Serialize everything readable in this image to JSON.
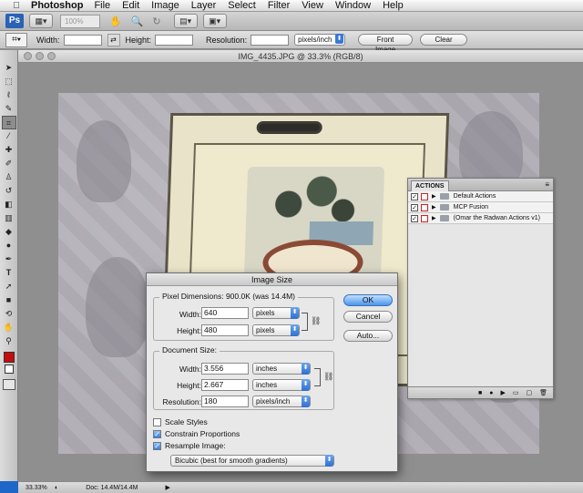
{
  "menubar": {
    "app_name": "Photoshop",
    "items": [
      "File",
      "Edit",
      "Image",
      "Layer",
      "Select",
      "Filter",
      "View",
      "Window",
      "Help"
    ]
  },
  "appbar": {
    "logo": "Ps",
    "zoom": "100%"
  },
  "options": {
    "width_label": "Width:",
    "height_label": "Height:",
    "resolution_label": "Resolution:",
    "units": "pixels/inch",
    "front_image": "Front Image",
    "clear": "Clear"
  },
  "document": {
    "title": "IMG_4435.JPG @ 33.3% (RGB/8)"
  },
  "actions_panel": {
    "tab": "ACTIONS",
    "rows": [
      {
        "name": "Default Actions"
      },
      {
        "name": "MCP Fusion"
      },
      {
        "name": "(Omar the Radwan Actions v1)"
      }
    ]
  },
  "dialog": {
    "title": "Image Size",
    "pixel_dimensions_label": "Pixel Dimensions:",
    "pixel_dimensions_value": "900.0K (was 14.4M)",
    "px_width_label": "Width:",
    "px_width_value": "640",
    "px_width_unit": "pixels",
    "px_height_label": "Height:",
    "px_height_value": "480",
    "px_height_unit": "pixels",
    "document_size_label": "Document Size:",
    "doc_width_label": "Width:",
    "doc_width_value": "3.556",
    "doc_width_unit": "inches",
    "doc_height_label": "Height:",
    "doc_height_value": "2.667",
    "doc_height_unit": "inches",
    "resolution_label": "Resolution:",
    "resolution_value": "180",
    "resolution_unit": "pixels/inch",
    "scale_styles": "Scale Styles",
    "constrain_proportions": "Constrain Proportions",
    "resample_image": "Resample Image:",
    "resample_method": "Bicubic (best for smooth gradients)",
    "ok": "OK",
    "cancel": "Cancel",
    "auto": "Auto..."
  },
  "statusbar": {
    "zoom": "33.33%",
    "doc": "Doc: 14.4M/14.4M"
  },
  "colors": {
    "foreground": "#c60d0d",
    "background": "#ffffff",
    "accent": "#3a78d8"
  }
}
